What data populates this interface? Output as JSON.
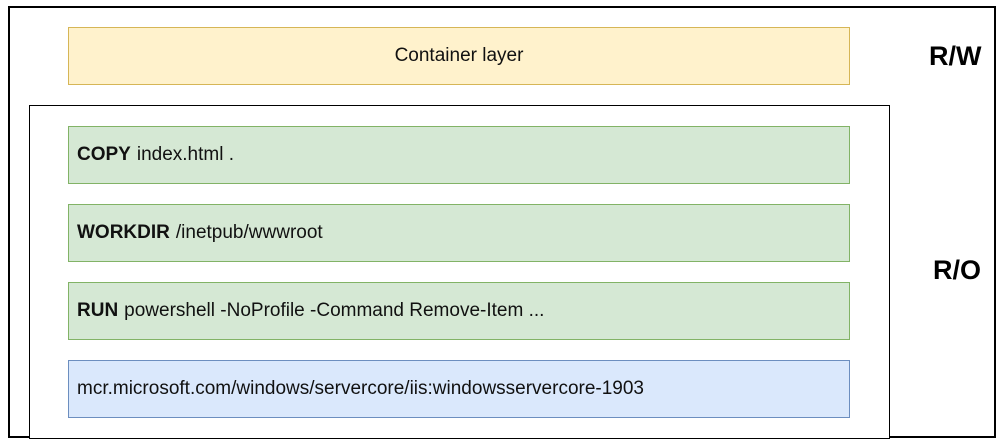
{
  "colors": {
    "writable_fill": "#fff2cc",
    "writable_border": "#d6b656",
    "instruction_fill": "#d5e8d4",
    "instruction_border": "#82b366",
    "base_fill": "#dae8fc",
    "base_border": "#6c8ebf"
  },
  "container_layer": {
    "label": "Container layer"
  },
  "access": {
    "read_write": "R/W",
    "read_only": "R/O"
  },
  "layers": [
    {
      "keyword": "COPY",
      "args": "index.html ."
    },
    {
      "keyword": "WORKDIR",
      "args": "/inetpub/wwwroot"
    },
    {
      "keyword": "RUN",
      "args": "powershell -NoProfile -Command Remove-Item ..."
    }
  ],
  "base_image": {
    "label": "mcr.microsoft.com/windows/servercore/iis:windowsservercore-1903"
  }
}
